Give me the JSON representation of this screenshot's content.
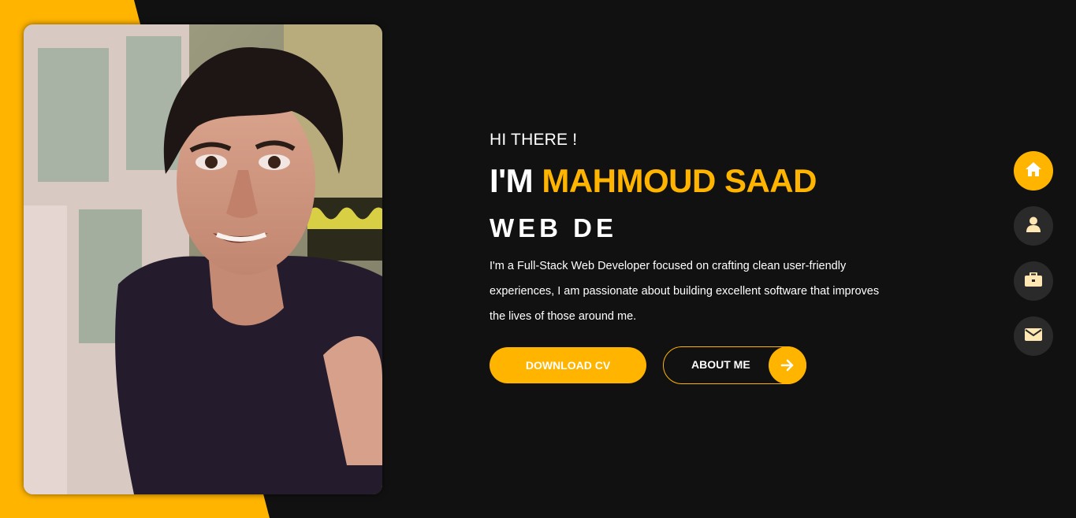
{
  "colors": {
    "accent": "#ffb400",
    "background": "#111111",
    "nav_inactive": "#2b2a2a",
    "nav_icon_inactive": "#ffe7b3",
    "text": "#ffffff"
  },
  "hero": {
    "greeting": "HI THERE !",
    "headline_prefix": "I'M",
    "name": "MAHMOUD SAAD",
    "typed_role": "WEB DE",
    "bio": "I'm a Full-Stack Web Developer focused on crafting clean user-friendly experiences, I am passionate about building excellent software that improves the lives of those around me.",
    "download_cv_label": "DOWNLOAD CV",
    "about_me_label": "ABOUT ME",
    "about_me_icon": "arrow-right-icon"
  },
  "profile_photo": {
    "alt": "profile photo"
  },
  "side_nav": {
    "items": [
      {
        "icon": "home-icon",
        "active": true
      },
      {
        "icon": "user-icon",
        "active": false
      },
      {
        "icon": "briefcase-icon",
        "active": false
      },
      {
        "icon": "envelope-icon",
        "active": false
      }
    ]
  }
}
